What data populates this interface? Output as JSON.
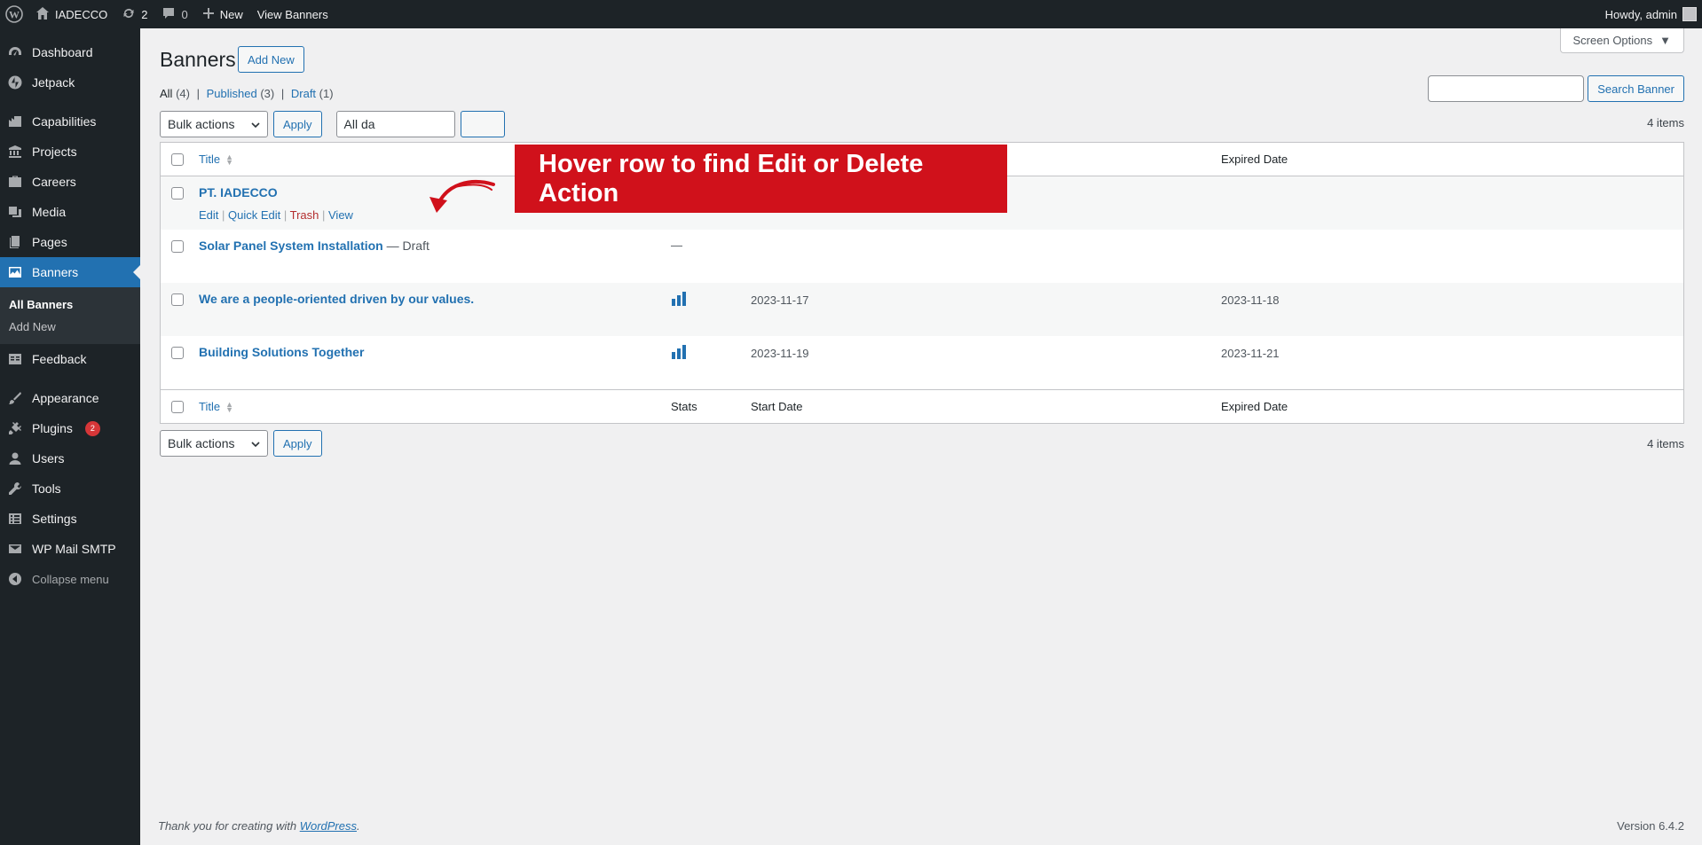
{
  "adminbar": {
    "site_name": "IADECCO",
    "updates_count": "2",
    "comments_count": "0",
    "new_label": "New",
    "view_label": "View Banners",
    "howdy": "Howdy, admin"
  },
  "sidebar": {
    "items": [
      {
        "label": "Dashboard",
        "icon": "dashboard-icon"
      },
      {
        "label": "Jetpack",
        "icon": "jetpack-icon"
      },
      {
        "label": "Capabilities",
        "icon": "capabilities-icon"
      },
      {
        "label": "Projects",
        "icon": "projects-icon"
      },
      {
        "label": "Careers",
        "icon": "careers-icon"
      },
      {
        "label": "Media",
        "icon": "media-icon"
      },
      {
        "label": "Pages",
        "icon": "pages-icon"
      },
      {
        "label": "Banners",
        "icon": "banners-icon"
      },
      {
        "label": "Feedback",
        "icon": "feedback-icon"
      },
      {
        "label": "Appearance",
        "icon": "appearance-icon"
      },
      {
        "label": "Plugins",
        "icon": "plugins-icon",
        "badge": "2"
      },
      {
        "label": "Users",
        "icon": "users-icon"
      },
      {
        "label": "Tools",
        "icon": "tools-icon"
      },
      {
        "label": "Settings",
        "icon": "settings-icon"
      },
      {
        "label": "WP Mail SMTP",
        "icon": "mail-icon"
      }
    ],
    "submenu": [
      "All Banners",
      "Add New"
    ],
    "collapse_label": "Collapse menu"
  },
  "header": {
    "title": "Banners",
    "add_new_label": "Add New",
    "screen_options_label": "Screen Options"
  },
  "filters": {
    "all_label": "All",
    "all_count": "(4)",
    "published_label": "Published",
    "published_count": "(3)",
    "draft_label": "Draft",
    "draft_count": "(1)",
    "separator": "|"
  },
  "search": {
    "button_label": "Search Banner",
    "value": ""
  },
  "tablenav": {
    "bulk_actions": "Bulk actions",
    "apply_label": "Apply",
    "dates_filter": "All da",
    "items_count": "4 items"
  },
  "table": {
    "columns": {
      "title": "Title",
      "stats": "Stats",
      "start_date": "Start Date",
      "expired_date": "Expired Date"
    },
    "rows": [
      {
        "title": "PT. IADECCO",
        "state": "",
        "stats": "stats-icon",
        "start": "",
        "expired": ""
      },
      {
        "title": "Solar Panel System Installation",
        "state": "— Draft",
        "stats": "—",
        "start": "",
        "expired": ""
      },
      {
        "title": "We are a people-oriented driven by our values.",
        "state": "",
        "stats": "stats-icon",
        "start": "2023-11-17",
        "expired": "2023-11-18"
      },
      {
        "title": "Building Solutions Together",
        "state": "",
        "stats": "stats-icon",
        "start": "2023-11-19",
        "expired": "2023-11-21"
      }
    ],
    "row_actions": {
      "edit": "Edit",
      "quick_edit": "Quick Edit",
      "trash": "Trash",
      "view": "View"
    }
  },
  "callout": {
    "text": "Hover row to find Edit or Delete Action"
  },
  "footer": {
    "thanks_prefix": "Thank you for creating with",
    "wordpress_link": "WordPress",
    "thanks_suffix": ".",
    "version": "Version 6.4.2"
  },
  "colors": {
    "accent": "#2271b1",
    "sidebar_bg": "#1d2327",
    "callout_bg": "#d0111b",
    "trash": "#b32d2e"
  }
}
